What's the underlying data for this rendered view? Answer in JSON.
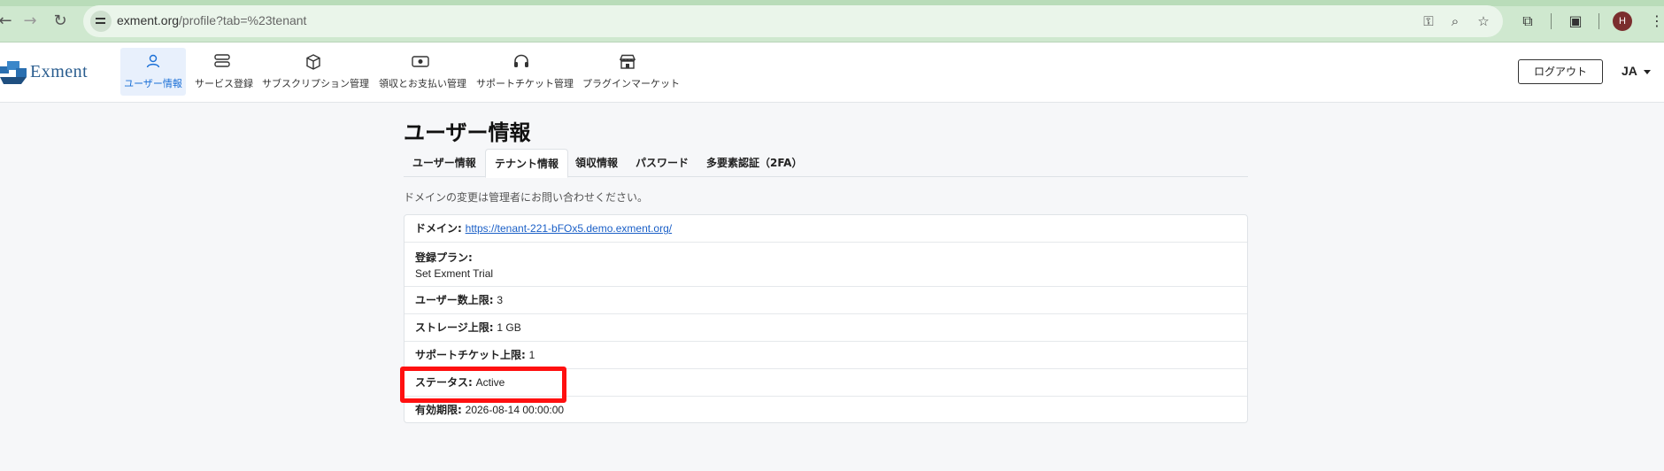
{
  "browser": {
    "url_host": "exment.org",
    "url_path": "/profile?tab=%23tenant",
    "profile_initial": "H"
  },
  "app": {
    "logo_text": "Exment",
    "nav": [
      {
        "label": "ユーザー情報",
        "icon": "user-icon",
        "active": true
      },
      {
        "label": "サービス登録",
        "icon": "server-icon",
        "active": false
      },
      {
        "label": "サブスクリプション管理",
        "icon": "box-icon",
        "active": false
      },
      {
        "label": "領収とお支払い管理",
        "icon": "cash-icon",
        "active": false
      },
      {
        "label": "サポートチケット管理",
        "icon": "headset-icon",
        "active": false
      },
      {
        "label": "プラグインマーケット",
        "icon": "shop-icon",
        "active": false
      }
    ],
    "logout_label": "ログアウト",
    "lang_label": "JA"
  },
  "page": {
    "title": "ユーザー情報",
    "tabs": [
      {
        "label": "ユーザー情報",
        "active": false
      },
      {
        "label": "テナント情報",
        "active": true
      },
      {
        "label": "領収情報",
        "active": false
      },
      {
        "label": "パスワード",
        "active": false
      },
      {
        "label": "多要素認証（2FA）",
        "active": false
      }
    ],
    "notice": "ドメインの変更は管理者にお問い合わせください。"
  },
  "tenant": {
    "domain_label": "ドメイン:",
    "domain_value": "https://tenant-221-bFOx5.demo.exment.org/",
    "plan_label": "登録プラン:",
    "plan_value": "Set Exment Trial",
    "user_limit_label": "ユーザー数上限:",
    "user_limit_value": "3",
    "storage_label": "ストレージ上限:",
    "storage_value": "1 GB",
    "ticket_label": "サポートチケット上限:",
    "ticket_value": "1",
    "status_label": "ステータス:",
    "status_value": "Active",
    "expiry_label": "有効期限:",
    "expiry_value": "2026-08-14 00:00:00"
  },
  "colors": {
    "accent": "#1a6fd6",
    "highlight": "#ff1010",
    "chrome_bg": "#cfe8cf"
  }
}
